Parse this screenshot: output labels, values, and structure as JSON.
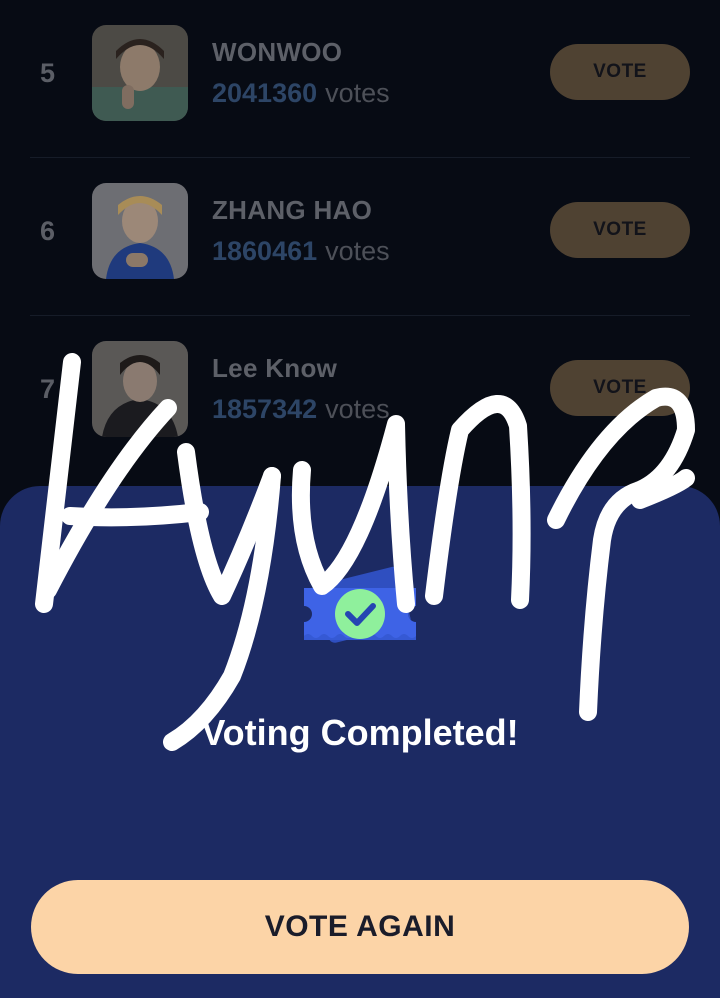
{
  "leaderboard": {
    "rows": [
      {
        "rank": "5",
        "name": "WONWOO",
        "votes": "2041360",
        "votes_unit": "votes",
        "button_label": "VOTE"
      },
      {
        "rank": "6",
        "name": "ZHANG HAO",
        "votes": "1860461",
        "votes_unit": "votes",
        "button_label": "VOTE"
      },
      {
        "rank": "7",
        "name": "Lee Know",
        "votes": "1857342",
        "votes_unit": "votes",
        "button_label": "VOTE"
      }
    ]
  },
  "completion_sheet": {
    "icon": "ticket-check-icon",
    "message": "Voting Completed!",
    "vote_again_label": "VOTE AGAIN"
  },
  "overlay": {
    "handwritten_text": "kyun?",
    "color": "#ffffff"
  },
  "colors": {
    "background": "#070b14",
    "sheet": "#1c2a63",
    "vote_button": "#4f4232",
    "vote_again_button": "#fcd4a7",
    "votes_number": "#2d4566",
    "check_badge": "#8ff09c",
    "ticket": "#3e63e6"
  }
}
